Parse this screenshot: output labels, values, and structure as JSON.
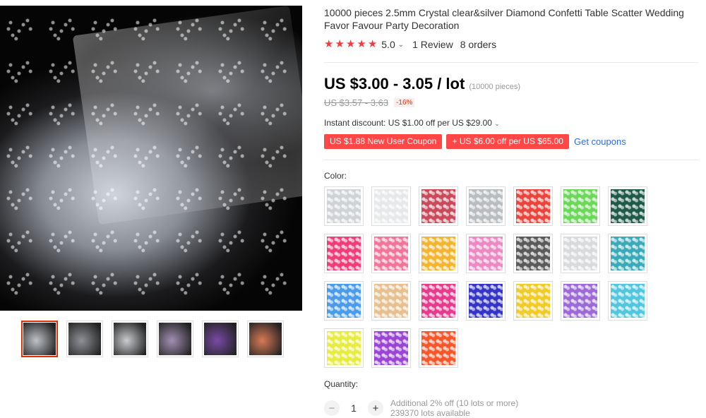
{
  "product": {
    "title": "10000 pieces 2.5mm Crystal clear&silver Diamond Confetti Table Scatter Wedding Favor Favour Party Decoration",
    "rating": {
      "stars": 5,
      "score": "5.0",
      "reviews": "1 Review",
      "orders": "8 orders",
      "star_color": "#f23c3c"
    },
    "price": {
      "current": "US $3.00 - 3.05 / lot",
      "unit_note": "(10000 pieces)",
      "original": "US $3.57 - 3.63",
      "discount": "-16%"
    },
    "instant_discount": "Instant discount: US $1.00 off per US $29.00",
    "coupons": [
      {
        "label": "US $1.88 New User Coupon"
      },
      {
        "label": "+ US $6.00 off per US $65.00"
      }
    ],
    "get_coupons": "Get coupons",
    "color_label": "Color:",
    "colors": [
      {
        "name": "crystal-clear",
        "hex": "#cfd3d8"
      },
      {
        "name": "white",
        "hex": "#e6e8ea"
      },
      {
        "name": "rose-red",
        "hex": "#c94b5b"
      },
      {
        "name": "silver",
        "hex": "#b9bcc0"
      },
      {
        "name": "red",
        "hex": "#e8453d"
      },
      {
        "name": "light-green",
        "hex": "#6bd85a"
      },
      {
        "name": "dark-green",
        "hex": "#1f5a48"
      },
      {
        "name": "hot-pink",
        "hex": "#ef3d7a"
      },
      {
        "name": "pink",
        "hex": "#f27599"
      },
      {
        "name": "gold-yellow",
        "hex": "#f2b431"
      },
      {
        "name": "light-pink",
        "hex": "#ec88c2"
      },
      {
        "name": "black",
        "hex": "#5a5a5a"
      },
      {
        "name": "pearl-white",
        "hex": "#d8dadc"
      },
      {
        "name": "teal",
        "hex": "#3aaab9"
      },
      {
        "name": "sky-blue",
        "hex": "#4b9bea"
      },
      {
        "name": "champagne",
        "hex": "#e7c090"
      },
      {
        "name": "fuchsia",
        "hex": "#e43b8c"
      },
      {
        "name": "royal-blue",
        "hex": "#3434c8"
      },
      {
        "name": "yellow",
        "hex": "#f0cb2a"
      },
      {
        "name": "lavender",
        "hex": "#9c6ad6"
      },
      {
        "name": "aqua",
        "hex": "#53c6df"
      },
      {
        "name": "lemon",
        "hex": "#e7ec42"
      },
      {
        "name": "purple",
        "hex": "#9a45d6"
      },
      {
        "name": "orange",
        "hex": "#f5572b"
      }
    ],
    "quantity_label": "Quantity:",
    "quantity_value": "1",
    "quantity_notes": {
      "additional": "Additional 2% off (10 lots or more)",
      "available": "239370 lots available"
    }
  },
  "gallery": {
    "thumbnails": [
      {
        "name": "thumb-crystal-pile",
        "hex": "#bfc3c9"
      },
      {
        "name": "thumb-silver-closeup",
        "hex": "#8e9197"
      },
      {
        "name": "thumb-bag",
        "hex": "#c9ccd0"
      },
      {
        "name": "thumb-assorted-bags",
        "hex": "#a38fb3"
      },
      {
        "name": "thumb-multicolor-dark",
        "hex": "#7a4aa6"
      },
      {
        "name": "thumb-multicolor-light",
        "hex": "#d97a56"
      }
    ]
  }
}
